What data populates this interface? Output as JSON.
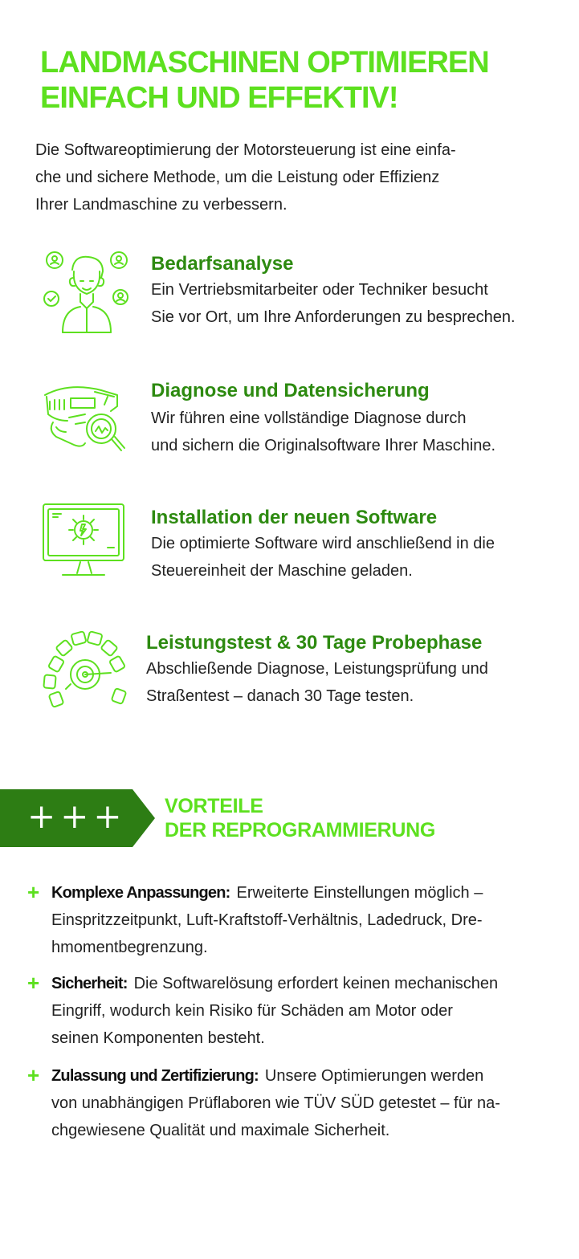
{
  "header": {
    "headline_line1": "LANDMASCHINEN OPTIMIEREN",
    "headline_line2": "EINFACH UND EFFEKTIV!",
    "intro_line1": "Die Softwareoptimierung der Motorsteuerung ist eine einfa-",
    "intro_line2": "che und sichere Methode, um die Leistung oder Effizienz",
    "intro_line3": "Ihrer Landmaschine zu verbessern."
  },
  "steps": [
    {
      "icon": "consultant-icon",
      "title": "Bedarfsanalyse",
      "line1": "Ein Vertriebsmitarbeiter oder Techniker besucht",
      "line2": "Sie vor Ort, um Ihre Anforderungen zu besprechen."
    },
    {
      "icon": "engine-diagnosis-icon",
      "title": "Diagnose und Datensicherung",
      "line1": "Wir führen eine vollständige Diagnose durch",
      "line2": "und sichern die Originalsoftware Ihrer Maschine."
    },
    {
      "icon": "monitor-gear-icon",
      "title": "Installation der neuen Software",
      "line1": "Die optimierte Software wird anschließend in die",
      "line2": "Steuereinheit der Maschine geladen."
    },
    {
      "icon": "gauge-icon",
      "title": "Leistungstest & 30 Tage Probephase",
      "line1": "Abschließende Diagnose, Leistungsprüfung und",
      "line2": "Straßentest – danach 30 Tage testen."
    }
  ],
  "vorteile": {
    "banner_symbols": "+++",
    "title_line1": "VORTEILE",
    "title_line2": "DER REPROGRAMMIERUNG",
    "items": [
      {
        "label": "Komplexe Anpassungen:",
        "line1": "Erweiterte Einstellungen möglich –",
        "line2": "Einspritzzeitpunkt, Luft-Kraftstoff-Verhältnis, Ladedruck, Dre-",
        "line3": "hmomentbegrenzung."
      },
      {
        "label": "Sicherheit:",
        "line1": "Die Softwarelösung erfordert keinen mechanischen",
        "line2": "Eingriff, wodurch kein Risiko für Schäden am Motor oder",
        "line3": "seinen Komponenten besteht."
      },
      {
        "label": "Zulassung und Zertifizierung:",
        "line1": "Unsere Optimierungen werden",
        "line2": "von unabhängigen Prüflaboren wie TÜV SÜD getestet – für na-",
        "line3": "chgewiesene Qualität und maximale Sicherheit."
      }
    ]
  },
  "colors": {
    "accent_green": "#5de01f",
    "dark_green": "#2d8a10",
    "banner_green": "#2d7d14"
  }
}
